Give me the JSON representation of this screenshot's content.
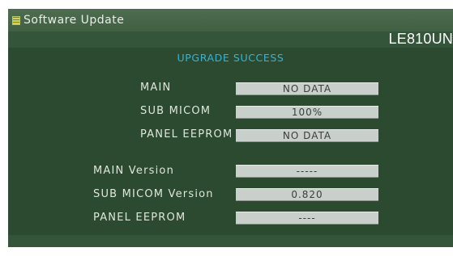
{
  "window": {
    "title": "Software Update",
    "model": "LE810UN"
  },
  "status_message": "UPGRADE SUCCESS",
  "update_status": {
    "main_label": "MAIN",
    "main_value": "NO DATA",
    "sub_micom_label": "SUB MICOM",
    "sub_micom_value": "100%",
    "panel_eeprom_label": "PANEL EEPROM",
    "panel_eeprom_value": "NO DATA"
  },
  "versions": {
    "main_version_label": "MAIN Version",
    "main_version_value": "-----",
    "sub_micom_version_label": "SUB MICOM Version",
    "sub_micom_version_value": "0.820",
    "panel_eeprom_label": "PANEL EEPROM",
    "panel_eeprom_value": "----"
  }
}
